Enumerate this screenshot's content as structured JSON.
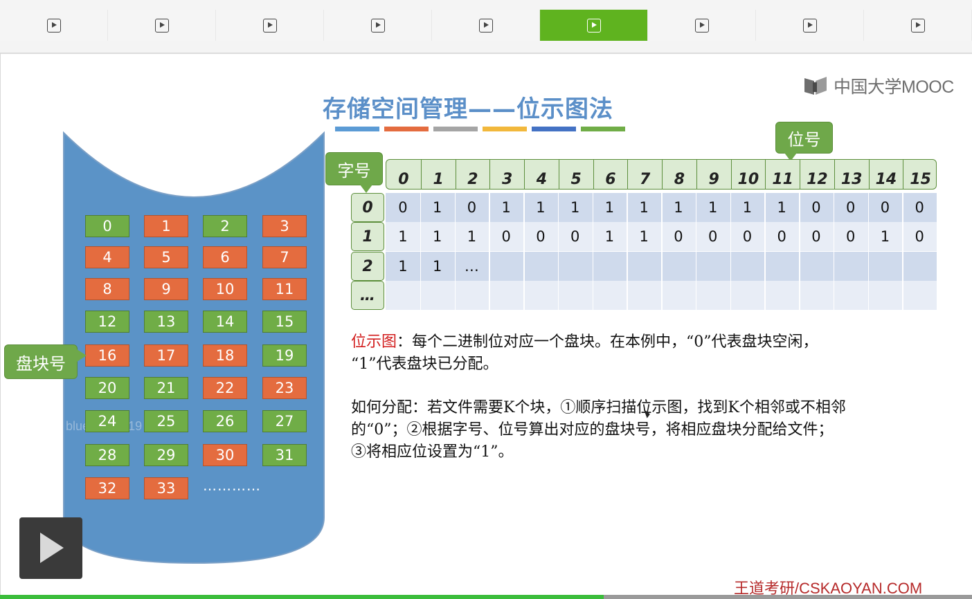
{
  "tabs": [
    {
      "icon": "play-icon",
      "active": false
    },
    {
      "icon": "play-icon",
      "active": false
    },
    {
      "icon": "play-icon",
      "active": false
    },
    {
      "icon": "play-icon",
      "active": false
    },
    {
      "icon": "play-icon",
      "active": false
    },
    {
      "icon": "play-icon",
      "active": true
    },
    {
      "icon": "play-icon",
      "active": false
    },
    {
      "icon": "play-icon",
      "active": false
    },
    {
      "icon": "play-icon",
      "active": false
    }
  ],
  "slide": {
    "title": "存储空间管理——位示图法",
    "title_bar_colors": [
      "#5b9bd5",
      "#e46c3f",
      "#a5a5a5",
      "#f2b83c",
      "#4472c4",
      "#70ad47"
    ],
    "logo_text": "中国大学MOOC",
    "callouts": {
      "bit_number": "位号",
      "word_number": "字号",
      "block_number": "盘块号"
    },
    "disk_blocks": [
      {
        "n": "0",
        "color": "green"
      },
      {
        "n": "1",
        "color": "orange"
      },
      {
        "n": "2",
        "color": "green"
      },
      {
        "n": "3",
        "color": "orange"
      },
      {
        "n": "4",
        "color": "orange"
      },
      {
        "n": "5",
        "color": "orange"
      },
      {
        "n": "6",
        "color": "orange"
      },
      {
        "n": "7",
        "color": "orange"
      },
      {
        "n": "8",
        "color": "orange"
      },
      {
        "n": "9",
        "color": "orange"
      },
      {
        "n": "10",
        "color": "orange"
      },
      {
        "n": "11",
        "color": "orange"
      },
      {
        "n": "12",
        "color": "green"
      },
      {
        "n": "13",
        "color": "green"
      },
      {
        "n": "14",
        "color": "green"
      },
      {
        "n": "15",
        "color": "green"
      },
      {
        "n": "16",
        "color": "orange"
      },
      {
        "n": "17",
        "color": "orange"
      },
      {
        "n": "18",
        "color": "orange"
      },
      {
        "n": "19",
        "color": "green"
      },
      {
        "n": "20",
        "color": "green"
      },
      {
        "n": "21",
        "color": "green"
      },
      {
        "n": "22",
        "color": "orange"
      },
      {
        "n": "23",
        "color": "orange"
      },
      {
        "n": "24",
        "color": "green"
      },
      {
        "n": "25",
        "color": "green"
      },
      {
        "n": "26",
        "color": "green"
      },
      {
        "n": "27",
        "color": "green"
      },
      {
        "n": "28",
        "color": "green"
      },
      {
        "n": "29",
        "color": "green"
      },
      {
        "n": "30",
        "color": "orange"
      },
      {
        "n": "31",
        "color": "green"
      },
      {
        "n": "32",
        "color": "orange"
      },
      {
        "n": "33",
        "color": "orange"
      }
    ],
    "disk_more": "…………",
    "watermark": "bluefeart2019",
    "bitmap": {
      "col_headers": [
        "0",
        "1",
        "2",
        "3",
        "4",
        "5",
        "6",
        "7",
        "8",
        "9",
        "10",
        "11",
        "12",
        "13",
        "14",
        "15"
      ],
      "row_labels": [
        "0",
        "1",
        "2",
        "…"
      ],
      "rows": [
        [
          "0",
          "1",
          "0",
          "1",
          "1",
          "1",
          "1",
          "1",
          "1",
          "1",
          "1",
          "1",
          "0",
          "0",
          "0",
          "0"
        ],
        [
          "1",
          "1",
          "1",
          "0",
          "0",
          "0",
          "1",
          "1",
          "0",
          "0",
          "0",
          "0",
          "0",
          "0",
          "1",
          "0"
        ],
        [
          "1",
          "1",
          "…",
          "",
          "",
          "",
          "",
          "",
          "",
          "",
          "",
          "",
          "",
          "",
          "",
          ""
        ],
        [
          "",
          "",
          "",
          "",
          "",
          "",
          "",
          "",
          "",
          "",
          "",
          "",
          "",
          "",
          "",
          ""
        ]
      ]
    },
    "para1": {
      "term": "位示图",
      "line1": "：每个二进制位对应一个盘块。在本例中，“0”代表盘块空闲，",
      "line2": "“1”代表盘块已分配。"
    },
    "para2": {
      "line1": "如何分配：若文件需要K个块，①顺序扫描位示图，找到K个相邻或不相邻",
      "line2": "的“0”；②根据字号、位号算出对应的盘块号，将相应盘块分配给文件；",
      "line3": "③将相应位设置为“1”。"
    },
    "credit": "王道考研/CSKAOYAN.COM"
  },
  "player": {
    "play_icon": "play-icon"
  }
}
